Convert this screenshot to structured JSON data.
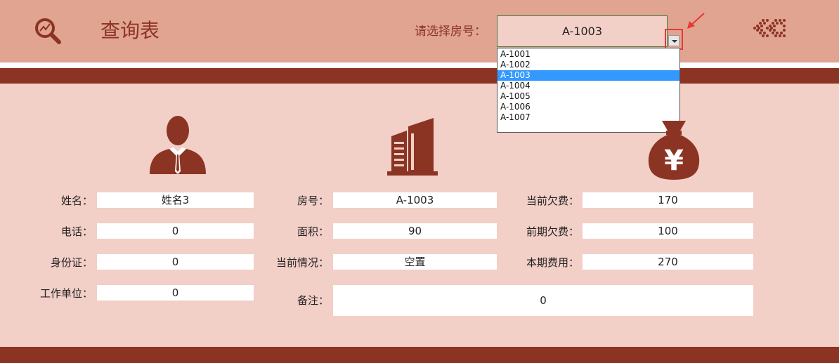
{
  "header": {
    "title": "查询表",
    "select_label": "请选择房号：",
    "selected_room": "A-1003",
    "dropdown_options": [
      "A-1001",
      "A-1002",
      "A-1003",
      "A-1004",
      "A-1005",
      "A-1006",
      "A-1007"
    ],
    "selected_index": 2
  },
  "colors": {
    "header_bg": "#e1a491",
    "band": "#8b3423",
    "body_bg": "#f2cfc7",
    "accent": "#8b3423",
    "highlight": "#3399ff",
    "annotation": "#e53935"
  },
  "icons": [
    "search-icon",
    "person-icon",
    "building-icon",
    "money-bag-icon",
    "back-arrows-icon"
  ],
  "money_icon_symbol": "¥",
  "person": {
    "name_label": "姓名：",
    "name_value": "姓名3",
    "phone_label": "电话：",
    "phone_value": "0",
    "id_label": "身份证：",
    "id_value": "0",
    "work_label": "工作单位：",
    "work_value": "0"
  },
  "room": {
    "room_label": "房号：",
    "room_value": "A-1003",
    "area_label": "面积：",
    "area_value": "90",
    "status_label": "当前情况：",
    "status_value": "空置",
    "note_label": "备注：",
    "note_value": "0"
  },
  "fees": {
    "current_owed_label": "当前欠费：",
    "current_owed_value": "170",
    "previous_owed_label": "前期欠费：",
    "previous_owed_value": "100",
    "this_period_label": "本期费用：",
    "this_period_value": "270"
  }
}
